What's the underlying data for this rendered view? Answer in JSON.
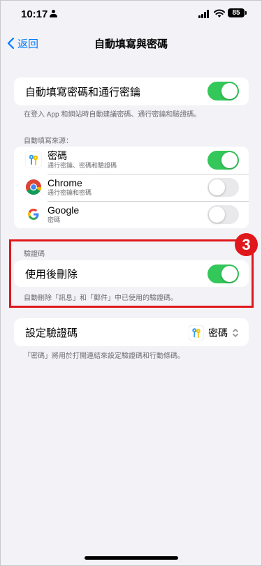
{
  "status_bar": {
    "time": "10:17",
    "battery": "85"
  },
  "nav": {
    "back_label": "返回",
    "title": "自動填寫與密碼"
  },
  "autofill": {
    "label": "自動填寫密碼和通行密鑰",
    "enabled": true,
    "footnote": "在登入 App 和網站時自動建議密碼、通行密鑰和驗證碼。"
  },
  "sources": {
    "header": "自動填寫來源：",
    "items": [
      {
        "name": "密碼",
        "subtitle": "通行密鑰、密碼和驗證碼",
        "icon": "passwords-app-icon",
        "enabled": true
      },
      {
        "name": "Chrome",
        "subtitle": "通行密鑰和密碼",
        "icon": "chrome-icon",
        "enabled": false
      },
      {
        "name": "Google",
        "subtitle": "密碼",
        "icon": "google-icon",
        "enabled": false
      }
    ]
  },
  "verification": {
    "header": "驗證碼",
    "delete_after_use_label": "使用後刪除",
    "delete_after_use_enabled": true,
    "footnote": "自動刪除「訊息」和「郵件」中已使用的驗證碼。"
  },
  "annotation": {
    "step": "3",
    "color": "#e0171b"
  },
  "setup": {
    "label": "設定驗證碼",
    "selected_app": "密碼",
    "footnote": "「密碼」將用於打開連結來設定驗證碼和行動條碼。"
  },
  "colors": {
    "accent": "#007aff",
    "toggle_on": "#34c759",
    "toggle_off": "#e9e9eb"
  }
}
